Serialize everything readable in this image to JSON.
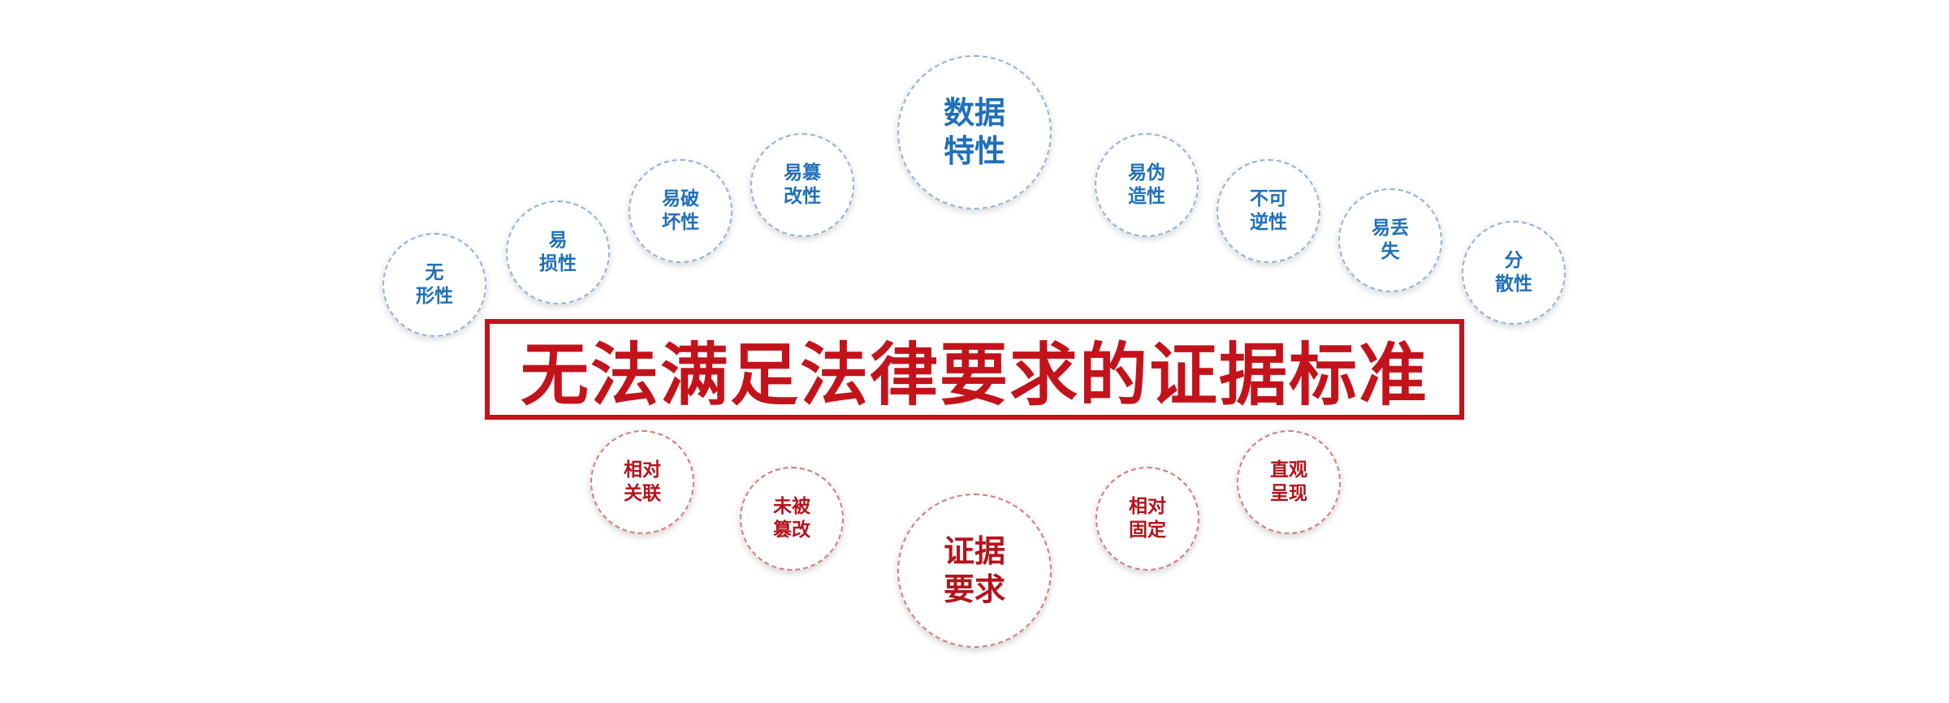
{
  "title": "无法满足法律要求的证据标准",
  "data_characteristics": {
    "center": "数据\n特性",
    "items": [
      "无\n形性",
      "易\n损性",
      "易破\n坏性",
      "易篡\n改性",
      "易伪\n造性",
      "不可\n逆性",
      "易丢\n失",
      "分\n散性"
    ]
  },
  "evidence_requirements": {
    "center": "证据\n要求",
    "items": [
      "相对\n关联",
      "未被\n篡改",
      "相对\n固定",
      "直观\n呈现"
    ]
  },
  "colors": {
    "blue_text": "#1f6fba",
    "red_text": "#b5121b",
    "title_red": "#c4121b"
  }
}
